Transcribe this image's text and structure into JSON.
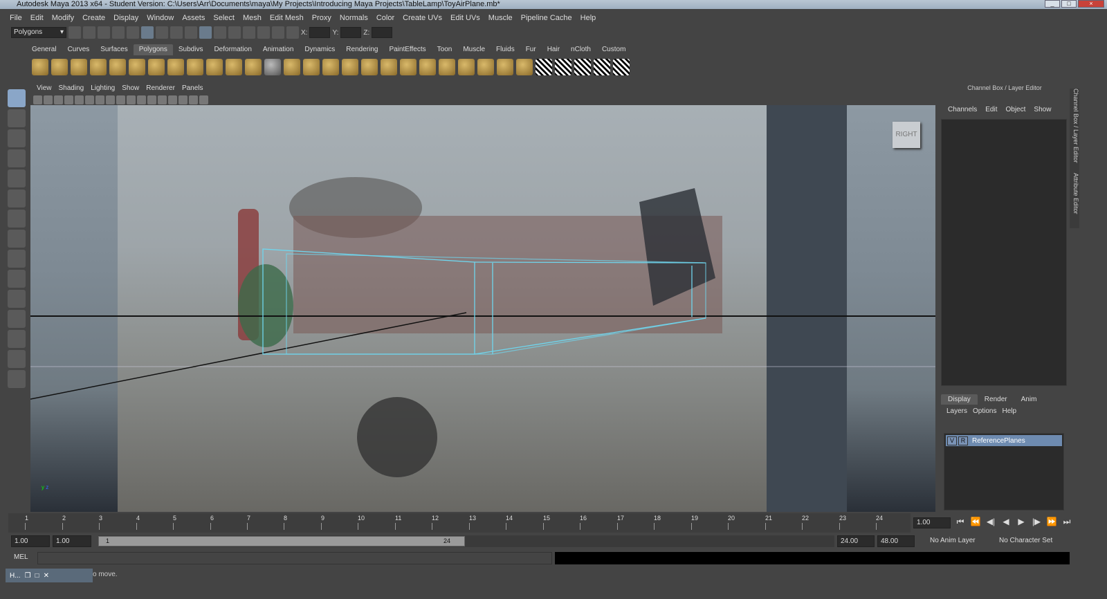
{
  "window": {
    "title": "Autodesk Maya 2013 x64 - Student Version: C:\\Users\\Arr\\Documents\\maya\\My Projects\\Introducing Maya Projects\\TableLamp\\ToyAirPlane.mb*"
  },
  "menubar": [
    "File",
    "Edit",
    "Modify",
    "Create",
    "Display",
    "Window",
    "Assets",
    "Select",
    "Mesh",
    "Edit Mesh",
    "Proxy",
    "Normals",
    "Color",
    "Create UVs",
    "Edit UVs",
    "Muscle",
    "Pipeline Cache",
    "Help"
  ],
  "statusline": {
    "menuset": "Polygons",
    "x_label": "X:",
    "y_label": "Y:",
    "z_label": "Z:"
  },
  "shelf": {
    "tabs": [
      "General",
      "Curves",
      "Surfaces",
      "Polygons",
      "Subdivs",
      "Deformation",
      "Animation",
      "Dynamics",
      "Rendering",
      "PaintEffects",
      "Toon",
      "Muscle",
      "Fluids",
      "Fur",
      "Hair",
      "nCloth",
      "Custom"
    ],
    "active": "Polygons"
  },
  "viewport": {
    "menus": [
      "View",
      "Shading",
      "Lighting",
      "Show",
      "Renderer",
      "Panels"
    ],
    "camera_label": "RIGHT",
    "axis_y": "y",
    "axis_z": "z"
  },
  "channelbox": {
    "header": "Channel Box / Layer Editor",
    "menus": [
      "Channels",
      "Edit",
      "Object",
      "Show"
    ]
  },
  "layer_editor": {
    "tabs": [
      "Display",
      "Render",
      "Anim"
    ],
    "active": "Display",
    "menus": [
      "Layers",
      "Options",
      "Help"
    ],
    "layers": [
      {
        "v": "V",
        "r": "R",
        "name": "ReferencePlanes"
      }
    ]
  },
  "side_tabs": {
    "channel_box": "Channel Box / Layer Editor",
    "attribute_editor": "Attribute Editor"
  },
  "timeline": {
    "ticks": [
      "1",
      "2",
      "3",
      "4",
      "5",
      "6",
      "7",
      "8",
      "9",
      "10",
      "11",
      "12",
      "13",
      "14",
      "15",
      "16",
      "17",
      "18",
      "19",
      "20",
      "21",
      "22",
      "23",
      "24"
    ],
    "current_frame": "1.00"
  },
  "range": {
    "start_time": "1.00",
    "playback_start": "1.00",
    "slider_start": "1",
    "slider_end": "24",
    "playback_end": "24.00",
    "end_time": "48.00",
    "anim_layer": "No Anim Layer",
    "character_set": "No Character Set"
  },
  "command": {
    "label": "MEL"
  },
  "help_line": {
    "text": "o move."
  },
  "taskbar": {
    "label": "H..."
  }
}
